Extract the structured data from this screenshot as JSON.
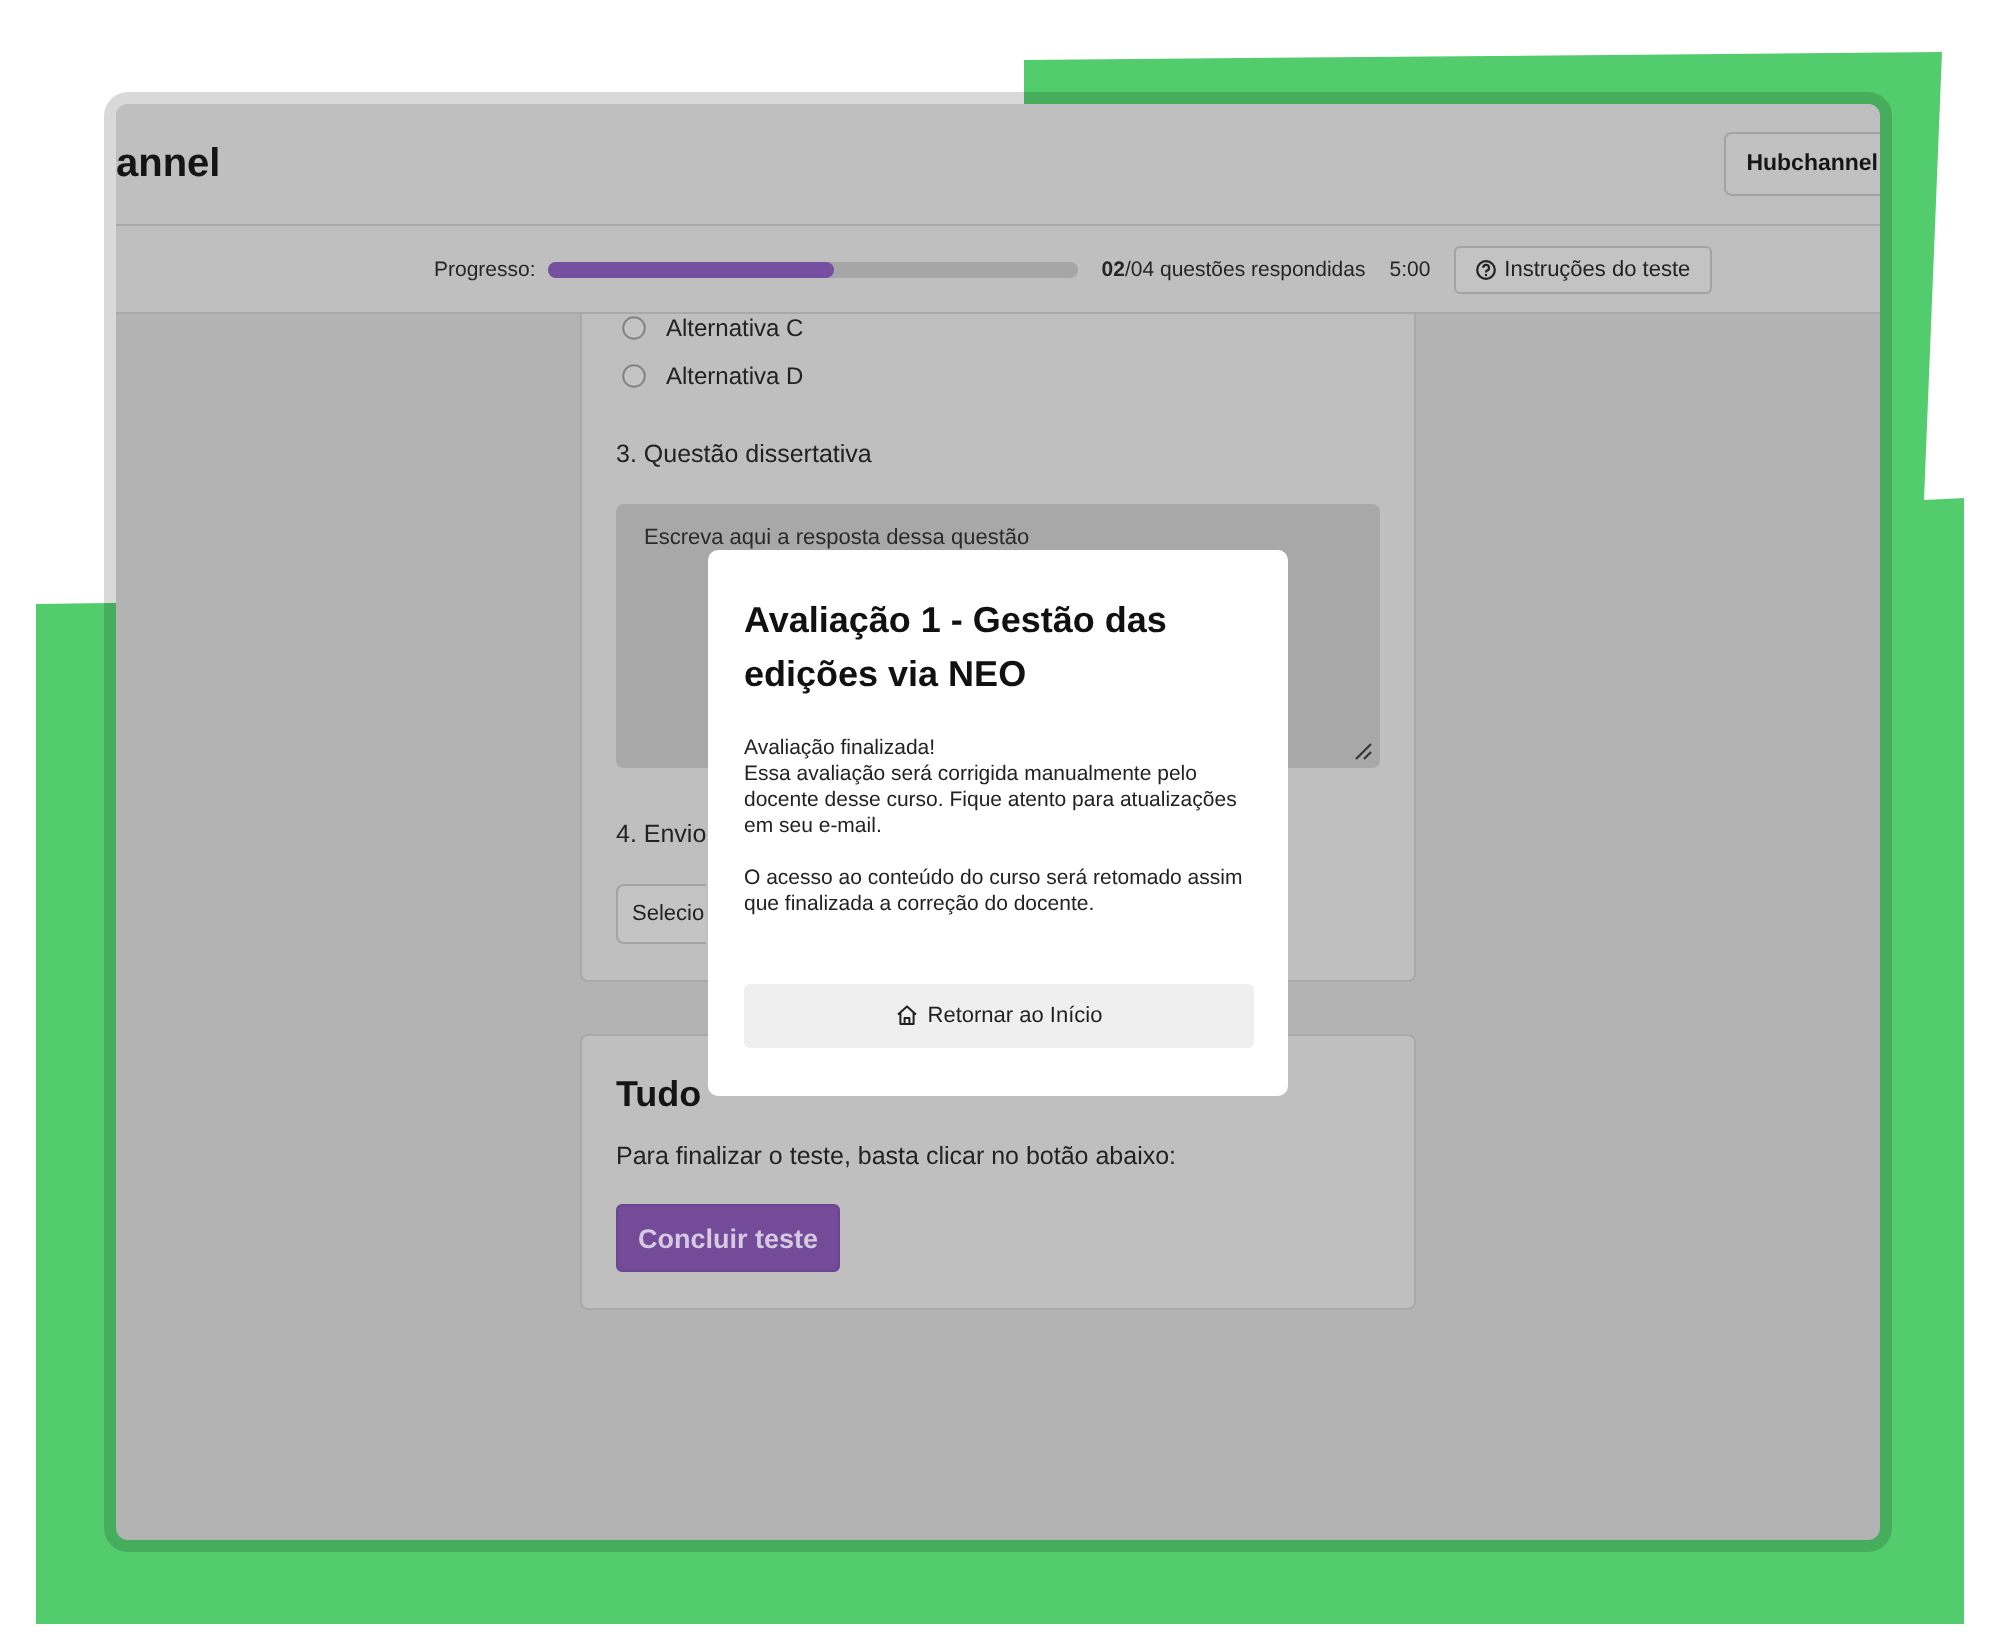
{
  "brand": {
    "text": "annel"
  },
  "account_button": {
    "label": "Hubchannel"
  },
  "progress": {
    "label": "Progresso:",
    "level": 0.54,
    "answered": "**02**/04 questões respondidas",
    "timer": "5:00",
    "instructions_button": {
      "label": "Instruções do teste"
    }
  },
  "question_card": {
    "options": [
      {
        "label": "Alternativa C",
        "selected": false
      },
      {
        "label": "Alternativa D",
        "selected": false
      }
    ],
    "essay": {
      "title": "3. Questão dissertativa",
      "placeholder": "Escreva aqui a resposta dessa questão"
    },
    "upload": {
      "title": "4. Envio",
      "select_value": "Selecio"
    }
  },
  "finish_card": {
    "title": "Tudo",
    "text": "Para finalizar o teste, basta clicar no botão abaixo:",
    "button": "Concluir teste"
  },
  "modal": {
    "title": "Avaliação 1 - Gestão das edições via NEO",
    "status": "Avaliação finalizada!",
    "paragraphs": [
      "Essa avaliação será corrigida manualmente pelo docente desse curso. Fique atento para atualizações em seu e-mail.",
      "O acesso ao conteúdo do curso será retomado assim que finalizada a correção do docente."
    ],
    "button": "Retornar ao Início"
  }
}
